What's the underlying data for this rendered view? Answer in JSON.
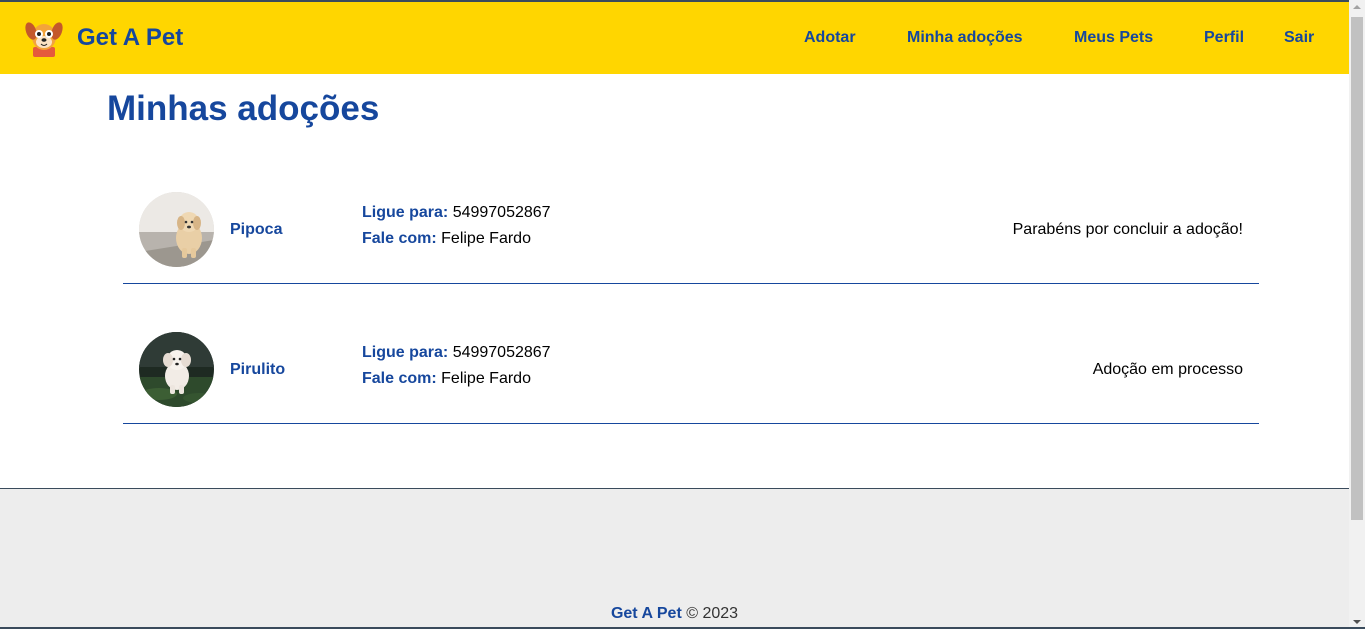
{
  "navbar": {
    "brand": "Get A Pet",
    "links": [
      "Adotar",
      "Minha adoções",
      "Meus Pets",
      "Perfil",
      "Sair"
    ]
  },
  "page": {
    "title": "Minhas adoções"
  },
  "adoptions": [
    {
      "name": "Pipoca",
      "call_label": "Ligue para:",
      "phone": "54997052867",
      "contact_label": "Fale com:",
      "contact_name": "Felipe Fardo",
      "status": "Parabéns por concluir a adoção!"
    },
    {
      "name": "Pirulito",
      "call_label": "Ligue para:",
      "phone": "54997052867",
      "contact_label": "Fale com:",
      "contact_name": "Felipe Fardo",
      "status": "Adoção em processo"
    }
  ],
  "footer": {
    "brand": "Get A Pet",
    "copyright": "© 2023"
  },
  "colors": {
    "navbar_bg": "#ffd600",
    "brand_blue": "#16479d",
    "footer_bg": "#ededed"
  }
}
